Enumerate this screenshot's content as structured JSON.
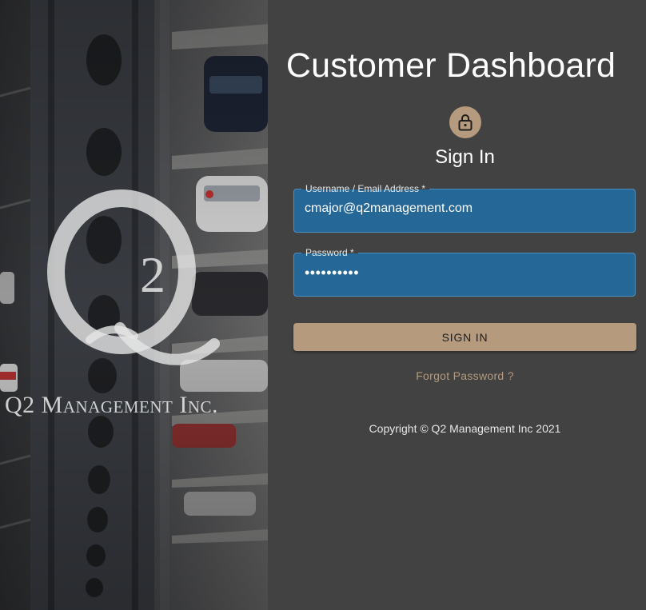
{
  "brand": {
    "logo_letters": "Q2",
    "logo_text": "Q2 Management Inc."
  },
  "panel": {
    "title": "Customer Dashboard",
    "lock_icon": "lock-icon",
    "signin_heading": "Sign In"
  },
  "form": {
    "username": {
      "label": "Username / Email Address *",
      "value": "cmajor@q2management.com"
    },
    "password": {
      "label": "Password *",
      "value": "••••••••••"
    },
    "submit_label": "SIGN IN",
    "forgot_label": "Forgot Password ?"
  },
  "footer": {
    "copyright": "Copyright © Q2 Management Inc 2021"
  },
  "colors": {
    "panel_bg": "#424242",
    "accent": "#b59a7e",
    "field_bg": "#256797"
  }
}
